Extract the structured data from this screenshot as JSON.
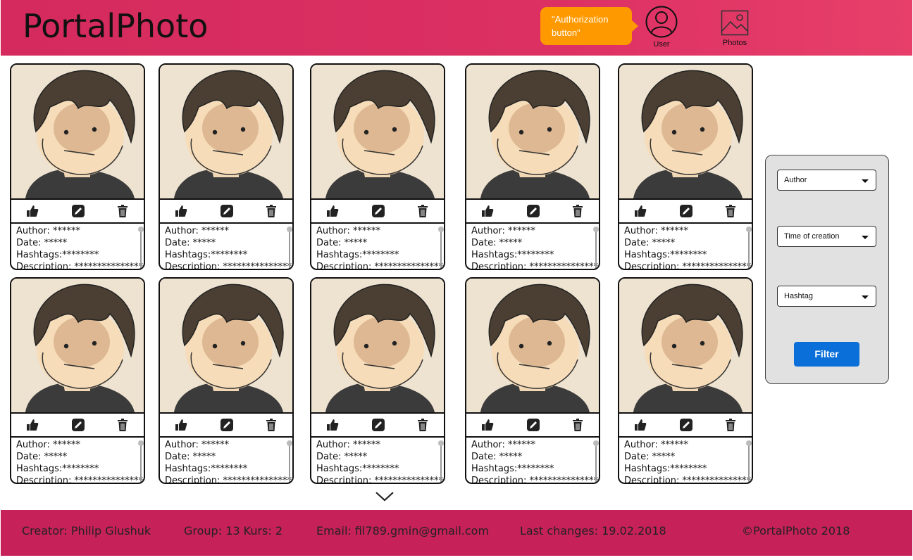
{
  "header": {
    "logo": "PortalPhoto",
    "callout": "\"Authorization\n button\"",
    "user_label": "User",
    "photos_label": "Photos"
  },
  "cards": [
    {
      "author": "Author: ******",
      "date": "Date: *****",
      "hashtags": "Hashtags:********",
      "description": "Description: ***************"
    },
    {
      "author": "Author: ******",
      "date": "Date: *****",
      "hashtags": "Hashtags:********",
      "description": "Description: ***************"
    },
    {
      "author": "Author: ******",
      "date": "Date: *****",
      "hashtags": "Hashtags:********",
      "description": "Description: ***************"
    },
    {
      "author": "Author: ******",
      "date": "Date: *****",
      "hashtags": "Hashtags:********",
      "description": "Description: ***************"
    },
    {
      "author": "Author: ******",
      "date": "Date: *****",
      "hashtags": "Hashtags:********",
      "description": "Description: ***************"
    },
    {
      "author": "Author: ******",
      "date": "Date: *****",
      "hashtags": "Hashtags:********",
      "description": "Description: ***************"
    },
    {
      "author": "Author: ******",
      "date": "Date: *****",
      "hashtags": "Hashtags:********",
      "description": "Description: ***************"
    },
    {
      "author": "Author: ******",
      "date": "Date: *****",
      "hashtags": "Hashtags:********",
      "description": "Description: ***************"
    },
    {
      "author": "Author: ******",
      "date": "Date: *****",
      "hashtags": "Hashtags:********",
      "description": "Description: ***************"
    },
    {
      "author": "Author: ******",
      "date": "Date: *****",
      "hashtags": "Hashtags:********",
      "description": "Description: ***************"
    }
  ],
  "filter": {
    "author": "Author",
    "time": "Time of creation",
    "hashtag": "Hashtag",
    "button": "Filter"
  },
  "footer": {
    "creator": "Creator: Philip Glushuk",
    "group": "Group: 13 Kurs: 2",
    "email": "Email: fil789.gmin@gmail.com",
    "last_changes": "Last changes: 19.02.2018",
    "copyright": "©PortalPhoto 2018"
  },
  "colors": {
    "header": "#dc3063",
    "footer": "#c72159",
    "callout": "#ff9900",
    "filter_button": "#0a6fd8"
  },
  "icons": [
    "user-icon",
    "photos-icon",
    "like-icon",
    "edit-icon",
    "delete-icon",
    "chevron-down-icon"
  ]
}
